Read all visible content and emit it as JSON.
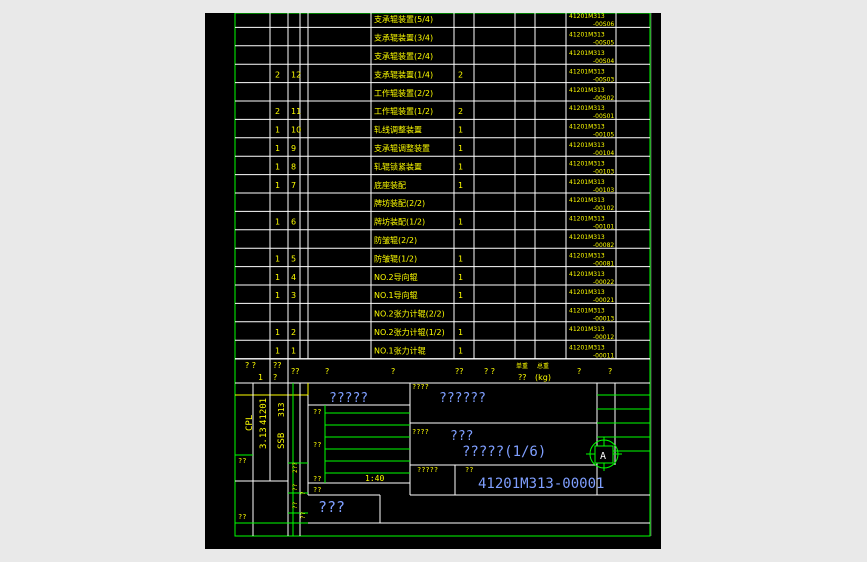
{
  "drawing": {
    "colors": {
      "background": "#000000",
      "frame_green": "#00ff00",
      "line_white": "#ffffff",
      "text_yellow": "#ffff00",
      "text_white": "#ffffff",
      "text_cyan": "#6fd3ff",
      "text_blue": "#7f9fff",
      "border_grey": "#5a5a5a",
      "page": "#e9e9e9"
    },
    "bom_rows": [
      {
        "qty": "",
        "seq": "",
        "name": "支承辊装置(5/4)",
        "q2": "",
        "code1": "41201M313",
        "code2": "-00S06"
      },
      {
        "qty": "",
        "seq": "",
        "name": "支承辊装置(3/4)",
        "q2": "",
        "code1": "41201M313",
        "code2": "-00S05"
      },
      {
        "qty": "",
        "seq": "",
        "name": "支承辊装置(2/4)",
        "q2": "",
        "code1": "41201M313",
        "code2": "-00S04"
      },
      {
        "qty": "2",
        "seq": "12",
        "name": "支承辊装置(1/4)",
        "q2": "2",
        "code1": "41201M313",
        "code2": "-00S03"
      },
      {
        "qty": "",
        "seq": "",
        "name": "工作辊装置(2/2)",
        "q2": "",
        "code1": "41201M313",
        "code2": "-00S02"
      },
      {
        "qty": "2",
        "seq": "11",
        "name": "工作辊装置(1/2)",
        "q2": "2",
        "code1": "41201M313",
        "code2": "-00S01"
      },
      {
        "qty": "1",
        "seq": "10",
        "name": "轧线调整装置",
        "q2": "1",
        "code1": "41201M313",
        "code2": "-00105"
      },
      {
        "qty": "1",
        "seq": "9",
        "name": "支承辊调整装置",
        "q2": "1",
        "code1": "41201M313",
        "code2": "-00104"
      },
      {
        "qty": "1",
        "seq": "8",
        "name": "轧辊锁紧装置",
        "q2": "1",
        "code1": "41201M313",
        "code2": "-00103"
      },
      {
        "qty": "1",
        "seq": "7",
        "name": "底座装配",
        "q2": "1",
        "code1": "41201M313",
        "code2": "-00103"
      },
      {
        "qty": "",
        "seq": "",
        "name": "牌坊装配(2/2)",
        "q2": "",
        "code1": "41201M313",
        "code2": "-00102"
      },
      {
        "qty": "1",
        "seq": "6",
        "name": "牌坊装配(1/2)",
        "q2": "1",
        "code1": "41201M313",
        "code2": "-00101"
      },
      {
        "qty": "",
        "seq": "",
        "name": "防皱辊(2/2)",
        "q2": "",
        "code1": "41201M313",
        "code2": "-00082"
      },
      {
        "qty": "1",
        "seq": "5",
        "name": "防皱辊(1/2)",
        "q2": "1",
        "code1": "41201M313",
        "code2": "-00081"
      },
      {
        "qty": "1",
        "seq": "4",
        "name": "NO.2导向辊",
        "q2": "1",
        "code1": "41201M313",
        "code2": "-00022"
      },
      {
        "qty": "1",
        "seq": "3",
        "name": "NO.1导向辊",
        "q2": "1",
        "code1": "41201M313",
        "code2": "-00021"
      },
      {
        "qty": "",
        "seq": "",
        "name": "NO.2张力计辊(2/2)",
        "q2": "",
        "code1": "41201M313",
        "code2": "-00013"
      },
      {
        "qty": "1",
        "seq": "2",
        "name": "NO.2张力计辊(1/2)",
        "q2": "1",
        "code1": "41201M313",
        "code2": "-00012"
      },
      {
        "qty": "1",
        "seq": "1",
        "name": "NO.1张力计辊",
        "q2": "1",
        "code1": "41201M313",
        "code2": "-00011"
      }
    ],
    "bom_header": {
      "h1": "? ?",
      "h2": "??",
      "h2b": "1",
      "h2c": "?",
      "h3": "??",
      "h4": "?",
      "h5": "?",
      "h6": "??",
      "h7": "? ?",
      "h8a": "单重",
      "h8b": "??",
      "h9a": "总重",
      "h9b": "(kg)",
      "h10": "?",
      "h11": "?"
    },
    "side_block": {
      "cpl": "CPL",
      "num1": "41201",
      "num2": "313",
      "num3": "3.13",
      "ssb": "SSB",
      "mark1": "??",
      "mark2": "??",
      "small_marks": [
        "2??",
        "??",
        "??",
        "??",
        "?"
      ]
    },
    "title_block": {
      "label_top": "????",
      "title_main": "?????",
      "subtitle": "??????",
      "label_mid": "????",
      "mid_text": "???",
      "drawing_title": "?????(1/6)",
      "label_low": "?????",
      "label_q": "??",
      "scale_label": "??",
      "scale": "1:40",
      "drawing_number": "41201M313-00001",
      "company": "???",
      "revision": "A",
      "sign_label1": "??",
      "sign_label2": "??",
      "sign_label3": "??"
    }
  }
}
